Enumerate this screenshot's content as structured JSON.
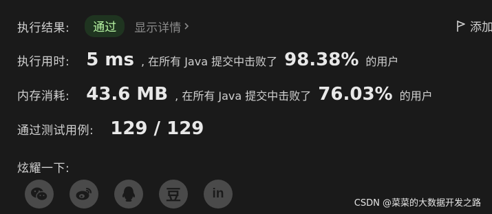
{
  "result": {
    "label": "执行结果:",
    "status": "通过",
    "details_link": "显示详情",
    "add_note": "添加"
  },
  "time": {
    "label": "执行用时:",
    "value": "5 ms",
    "text": ", 在所有 Java 提交中击败了",
    "percent": "98.38%",
    "suffix": "的用户"
  },
  "memory": {
    "label": "内存消耗:",
    "value": "43.6 MB",
    "text": ", 在所有 Java 提交中击败了",
    "percent": "76.03%",
    "suffix": "的用户"
  },
  "tests": {
    "label": "通过测试用例:",
    "value": "129 / 129"
  },
  "share": {
    "label": "炫耀一下:",
    "icons": [
      "wechat-icon",
      "weibo-icon",
      "qq-icon",
      "douban-icon",
      "linkedin-icon"
    ],
    "douban_glyph": "豆",
    "linkedin_glyph": "in"
  },
  "watermark": "CSDN @菜菜的大数据开发之路",
  "colors": {
    "background": "#1a1a1a",
    "pass_badge_bg": "#1f3420",
    "pass_text": "#b7f5a3",
    "icon_bg": "#4a4a4a"
  }
}
